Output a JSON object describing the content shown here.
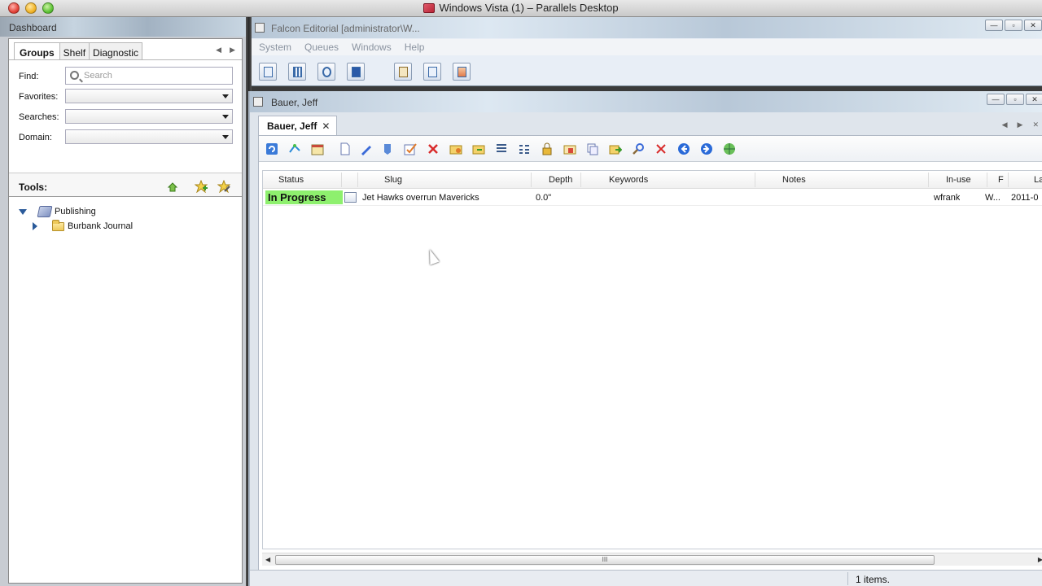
{
  "mac": {
    "title": "Windows Vista (1) – Parallels Desktop"
  },
  "dashboard": {
    "title": "Dashboard",
    "tabs": [
      "Groups",
      "Shelf",
      "Diagnostic"
    ],
    "find_label": "Find:",
    "search_placeholder": "Search",
    "favorites_label": "Favorites:",
    "searches_label": "Searches:",
    "domain_label": "Domain:",
    "tools_label": "Tools:",
    "tree": {
      "root": "Publishing",
      "child": "Burbank Journal"
    }
  },
  "falcon": {
    "title": "Falcon Editorial [administrator\\W...",
    "menu": [
      "System",
      "Queues",
      "Windows",
      "Help"
    ]
  },
  "bauer": {
    "title": "Bauer, Jeff",
    "tab": "Bauer, Jeff",
    "columns": [
      "Status",
      "Slug",
      "Depth",
      "Keywords",
      "Notes",
      "In-use",
      "F",
      "La"
    ],
    "rows": [
      {
        "status": "In Progress",
        "slug": "Jet Hawks overrun Mavericks",
        "depth": "0.0\"",
        "keywords": "",
        "notes": "",
        "inuse": "wfrank",
        "f": "W...",
        "la": "2011-0"
      }
    ],
    "status_color": "#8ef06e",
    "scroll_grip": "III",
    "item_count": "1 items."
  }
}
